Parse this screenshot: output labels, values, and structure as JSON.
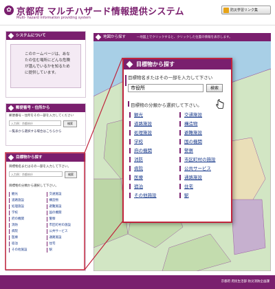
{
  "header": {
    "title": "京都府 マルチハザード情報提供システム",
    "subtitle": "Multi- hazard information providing system",
    "bosai_link_label": "防災学習リンク集"
  },
  "sidebar": {
    "about": {
      "title": "システムについて",
      "text": "このホームページは、あなたの住む場所にどんな危険が潜んでいるかを知るために提供しています。"
    },
    "registration": {
      "title": "郵便番号・住所から",
      "text": "郵便番号・住所をその一部を入力してください",
      "input_placeholder": "入力例：京都府庁",
      "button_label": "検索",
      "link_text": "一覧表から選択する場合はこちらから"
    },
    "landmark_small": {
      "title": "目標物から探す",
      "desc": "目標物名またはその一部を入力して下さい。",
      "input_placeholder": "入力例：京都府庁",
      "button_label": "検索",
      "desc2": "目標物の分類から選択して下さい。",
      "categories": [
        "観光",
        "道路施設",
        "処理施設",
        "学校",
        "府の機関",
        "消防",
        "病院",
        "医療",
        "宿泊",
        "その他施設",
        "交通施設",
        "構造物",
        "避難施設",
        "国の機関",
        "警察",
        "市区町村の施設",
        "公共サービス",
        "通路施設",
        "住宅",
        "駅"
      ]
    }
  },
  "map": {
    "title": "地図から探す",
    "hint": "一地図上でクリックすると、クリックした位置の情報を表示します。"
  },
  "callout": {
    "title": "目標物から探す",
    "desc": "目標物名またはその一部を入力して下さい",
    "input_value": "市役所",
    "button_label": "検索",
    "desc2": "目標物の分類から選択して下さい。",
    "categories": [
      "観光",
      "道路施設",
      "処理施設",
      "学校",
      "府の機関",
      "消防",
      "病院",
      "医療",
      "宿泊",
      "その他施設",
      "交通施設",
      "構造物",
      "避難施設",
      "国の機関",
      "警察",
      "市区町村の施設",
      "公共サービス",
      "通路施設",
      "住宅",
      "駅"
    ]
  },
  "footer": {
    "text": "京都府 府民生活部 防災消防企画課"
  },
  "colors": {
    "brand": "#7a1f6e",
    "callout_border": "#c0243c",
    "link": "#1a3b8c"
  }
}
